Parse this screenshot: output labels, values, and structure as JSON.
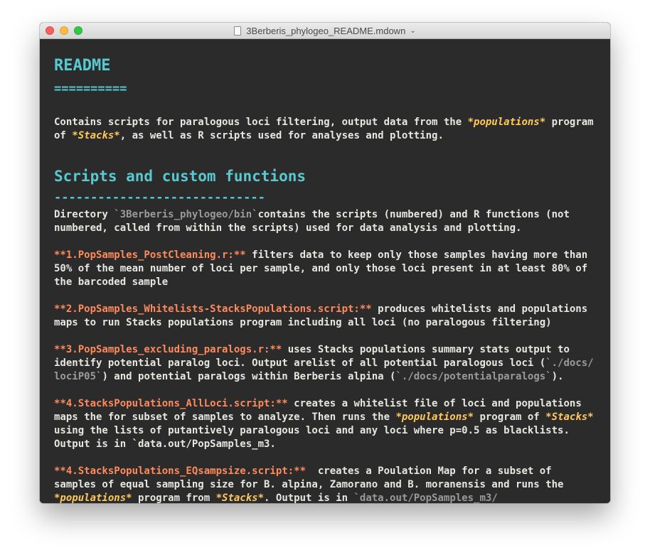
{
  "window": {
    "title": "3Berberis_phylogeo_README.mdown"
  },
  "doc": {
    "h1": "README",
    "h1_underline": "==========",
    "intro": {
      "l1a": "Contains scripts for paralogous loci filtering, output data from the ",
      "l1b": "*populations*",
      "l1c": " program",
      "l2a": "of ",
      "l2b": "*Stacks*",
      "l2c": ", as well as R scripts used for analyses and plotting."
    },
    "h2": "Scripts and custom functions",
    "h2_underline": "-----------------------------",
    "dir": {
      "l1a": "Directory ",
      "l1b": "`3Berberis_phylogeo/bin`",
      "l1c": "contains the scripts (numbered) and R functions (not",
      "l2": "numbered, called from within the scripts) used for data analysis and plotting."
    },
    "item1": {
      "bold": "**1.PopSamples_PostCleaning.r:**",
      "l1": " filters data to keep only those samples having more than",
      "l2": "50% of the mean number of loci per sample, and only those loci present in at least 80% of",
      "l3": "the barcoded sample"
    },
    "item2": {
      "bold": "**2.PopSamples_Whitelists-StacksPopulations.script:**",
      "l1": " produces whitelists and populations",
      "l2": "maps to run Stacks populations program including all loci (no paralogous filtering)"
    },
    "item3": {
      "bold": "**3.PopSamples_excluding_paralogs.r:**",
      "l1": " uses Stacks populations summary stats output to",
      "l2": "identify potential paralog loci. Output arelist of all potential paralogous loci (",
      "l2code": "`./docs/",
      "l3code": "lociP05`",
      "l3b": ") and potential paralogs within Berberis alpina (",
      "l3code2": "`./docs/potentialparalogs`",
      "l3c": ")."
    },
    "item4": {
      "bold": "**4.StacksPopulations_AllLoci.script:**",
      "l1": " creates a whitelist file of loci and populations",
      "l2a": "maps the for subset of samples to analyze. Then runs the ",
      "l2b": "*populations*",
      "l2c": " program of ",
      "l2d": "*Stacks*",
      "l3": "using the lists of putantively paralogous loci and any loci where p=0.5 as blacklists.",
      "l4": "Output is in `data.out/PopSamples_m3."
    },
    "item5": {
      "bold": "**4.StacksPopulations_EQsampsize.script:**",
      "l1": "  creates a Poulation Map for a subset of",
      "l2": "samples of equal sampling size for B. alpina, Zamorano and B. moranensis and runs the",
      "l3a": "*populations*",
      "l3b": " program from ",
      "l3c": "*Stacks*",
      "l3d": ". Output is in ",
      "l3e": "`data.out/PopSamples_m3/"
    }
  }
}
